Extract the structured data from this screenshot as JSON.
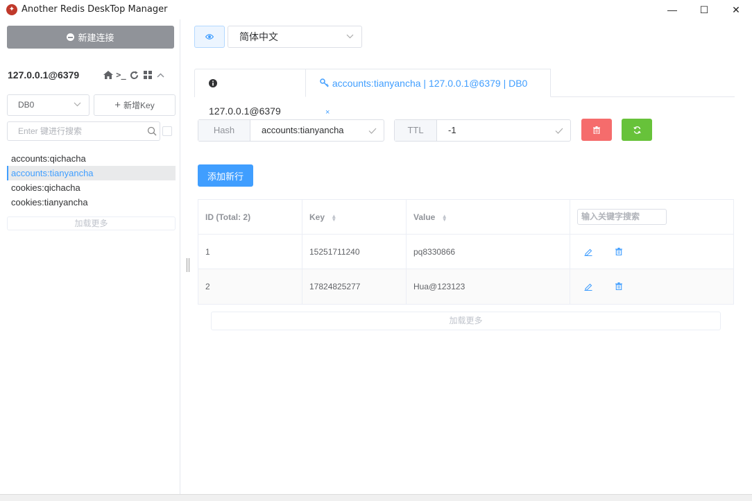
{
  "window": {
    "title": "Another Redis DeskTop Manager",
    "minimize": "—",
    "maximize": "☐",
    "close": "✕"
  },
  "sidebar": {
    "new_connection_label": "新建连接",
    "connection_name": "127.0.0.1@6379",
    "db_select": {
      "value": "DB0"
    },
    "add_key_label": "新增Key",
    "search_placeholder": "Enter 键进行搜索",
    "keys": [
      {
        "name": "accounts:qichacha",
        "active": false
      },
      {
        "name": "accounts:tianyancha",
        "active": true
      },
      {
        "name": "cookies:qichacha",
        "active": false
      },
      {
        "name": "cookies:tianyancha",
        "active": false
      }
    ],
    "load_more_label": "加载更多"
  },
  "toolbar": {
    "language": "简体中文"
  },
  "tabs": [
    {
      "label": "127.0.0.1@6379",
      "icon": "info-icon"
    },
    {
      "label": "accounts:tianyancha | 127.0.0.1@6379 | DB0",
      "icon": "key-icon",
      "close": "×"
    }
  ],
  "key_detail": {
    "type_label": "Hash",
    "key_name": "accounts:tianyancha",
    "ttl_label": "TTL",
    "ttl_value": "-1",
    "add_row_label": "添加新行"
  },
  "table": {
    "headers": {
      "id": "ID (Total: 2)",
      "key": "Key",
      "value": "Value"
    },
    "search_placeholder": "输入关键字搜索",
    "rows": [
      {
        "id": "1",
        "key": "15251711240",
        "value": "pq8330866"
      },
      {
        "id": "2",
        "key": "17824825277",
        "value": "Hua@123123"
      }
    ],
    "load_more_label": "加载更多"
  },
  "colors": {
    "primary": "#409eff",
    "danger": "#f56c6c",
    "success": "#67c23a",
    "info": "#909399"
  }
}
